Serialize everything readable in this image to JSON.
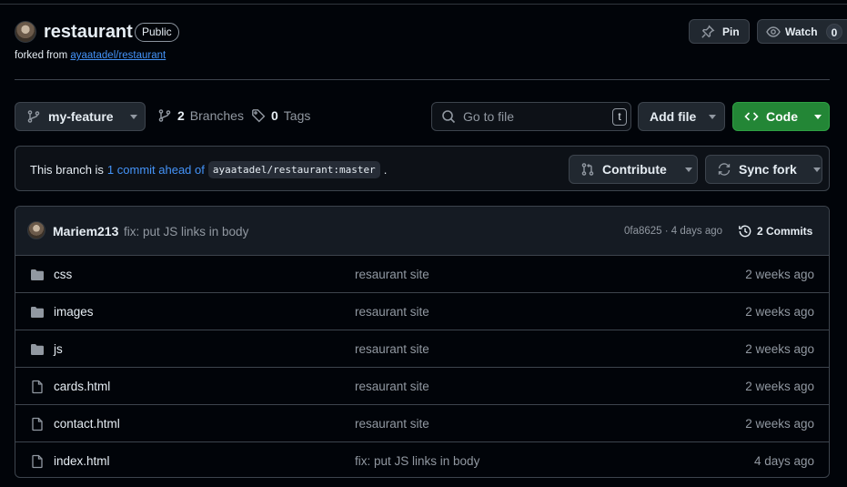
{
  "repo": {
    "name": "restaurant",
    "visibility": "Public",
    "forked_prefix": "forked from",
    "forked_from": "ayaatadel/restaurant"
  },
  "header_actions": {
    "pin_label": "Pin",
    "watch_label": "Watch",
    "watch_count": "0"
  },
  "toolbar": {
    "branch": "my-feature",
    "branches_count": "2",
    "branches_label": "Branches",
    "tags_count": "0",
    "tags_label": "Tags",
    "search_placeholder": "Go to file",
    "search_shortcut": "t",
    "add_file_label": "Add file",
    "code_label": "Code"
  },
  "fork_status": {
    "prefix": "This branch is",
    "link": "1 commit ahead of",
    "target": "ayaatadel/restaurant:master",
    "suffix": ".",
    "contribute_label": "Contribute",
    "sync_label": "Sync fork"
  },
  "latest_commit": {
    "author": "Mariem213",
    "message": "fix: put JS links in body",
    "sha_time": "0fa8625 · 4 days ago",
    "commits_label": "2 Commits"
  },
  "files": [
    {
      "name": "css",
      "type": "folder",
      "message": "resaurant site",
      "time": "2 weeks ago"
    },
    {
      "name": "images",
      "type": "folder",
      "message": "resaurant site",
      "time": "2 weeks ago"
    },
    {
      "name": "js",
      "type": "folder",
      "message": "resaurant site",
      "time": "2 weeks ago"
    },
    {
      "name": "cards.html",
      "type": "file",
      "message": "resaurant site",
      "time": "2 weeks ago"
    },
    {
      "name": "contact.html",
      "type": "file",
      "message": "resaurant site",
      "time": "2 weeks ago"
    },
    {
      "name": "index.html",
      "type": "file",
      "message": "fix: put JS links in body",
      "time": "4 days ago"
    }
  ],
  "colors": {
    "background": "#010409",
    "link": "#4493f8",
    "code_button": "#238636",
    "muted_text": "#9198a1"
  }
}
